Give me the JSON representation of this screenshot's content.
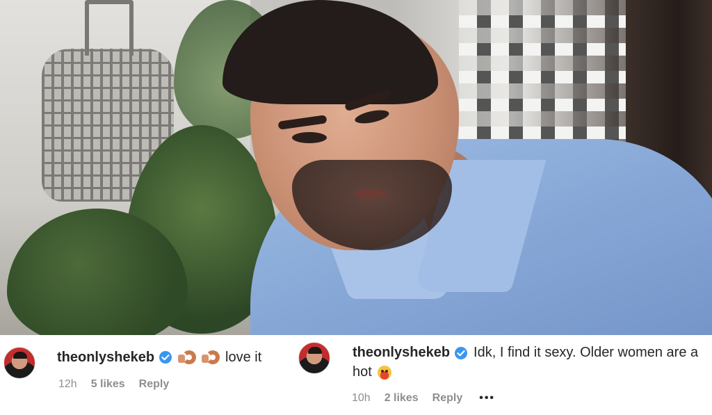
{
  "photo": {
    "description_icon": "video-frame"
  },
  "comments": [
    {
      "username": "theonlyshekeb",
      "verified": true,
      "emoji": [
        "pinching-hand",
        "pinching-hand"
      ],
      "text": "love it",
      "time": "12h",
      "likes": "5 likes",
      "reply_label": "Reply"
    },
    {
      "username": "theonlyshekeb",
      "verified": true,
      "text_line1": "Idk, I find it sexy. Older women are a",
      "text_line2": "hot",
      "emoji": [
        "flushed-face"
      ],
      "time": "10h",
      "likes": "2 likes",
      "reply_label": "Reply",
      "more_label": "•••"
    }
  ],
  "colors": {
    "verified_badge": "#3897f0",
    "text_primary": "#262626",
    "text_secondary": "#8e8e8e"
  }
}
